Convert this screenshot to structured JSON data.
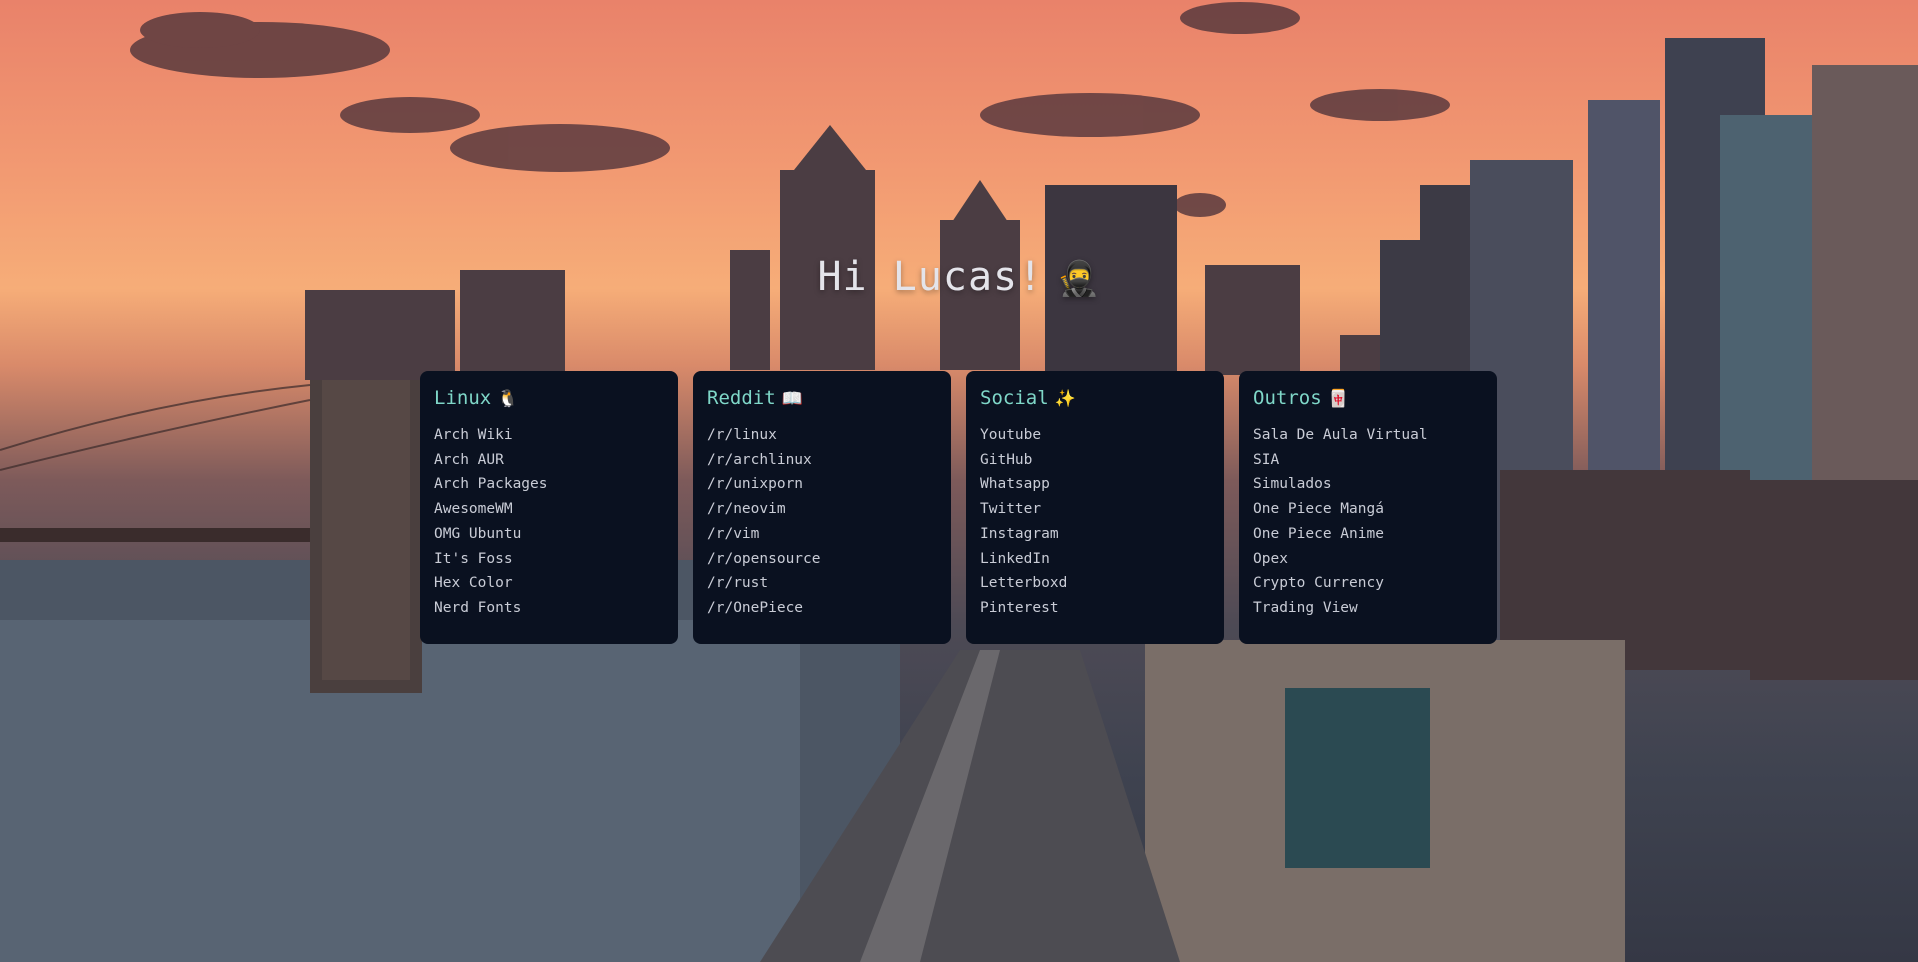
{
  "greeting": {
    "text": "Hi Lucas!",
    "emoji": "🥷"
  },
  "cards": [
    {
      "title": "Linux",
      "emoji": "🐧",
      "links": [
        "Arch Wiki",
        "Arch AUR",
        "Arch Packages",
        "AwesomeWM",
        "OMG Ubuntu",
        "It's Foss",
        "Hex Color",
        "Nerd Fonts"
      ]
    },
    {
      "title": "Reddit",
      "emoji": "📖",
      "links": [
        "/r/linux",
        "/r/archlinux",
        "/r/unixporn",
        "/r/neovim",
        "/r/vim",
        "/r/opensource",
        "/r/rust",
        "/r/OnePiece"
      ]
    },
    {
      "title": "Social",
      "emoji": "✨",
      "links": [
        "Youtube",
        "GitHub",
        "Whatsapp",
        "Twitter",
        "Instagram",
        "LinkedIn",
        "Letterboxd",
        "Pinterest"
      ]
    },
    {
      "title": "Outros",
      "emoji": "🀄",
      "links": [
        "Sala De Aula Virtual",
        "SIA",
        "Simulados",
        "One Piece Mangá",
        "One Piece Anime",
        "Opex",
        "Crypto Currency",
        "Trading View"
      ]
    }
  ],
  "colors": {
    "card_background": "#0a1120",
    "card_title": "#7fd7c8",
    "link_text": "#c9ccd6",
    "greeting_text": "#e4e4ea"
  }
}
